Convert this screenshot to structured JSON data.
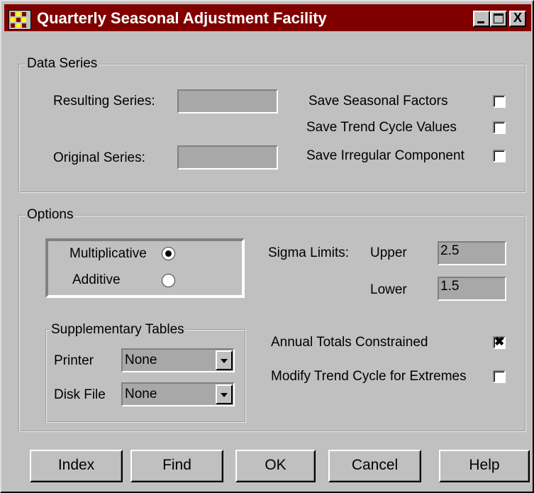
{
  "window": {
    "title": "Quarterly Seasonal Adjustment Facility"
  },
  "title_buttons": {
    "close": "X"
  },
  "data_series": {
    "label": "Data Series",
    "resulting_label": "Resulting Series:",
    "resulting_value": "",
    "original_label": "Original Series:",
    "original_value": "",
    "save_seasonal": {
      "label": "Save Seasonal Factors",
      "checked": false
    },
    "save_trend": {
      "label": "Save Trend Cycle Values",
      "checked": false
    },
    "save_irregular": {
      "label": "Save Irregular  Component",
      "checked": false
    }
  },
  "options": {
    "label": "Options",
    "multiplicative": {
      "label": "Multiplicative",
      "selected": true
    },
    "additive": {
      "label": "Additive",
      "selected": false
    },
    "sigma_label": "Sigma Limits:",
    "upper_label": "Upper",
    "upper_value": "2.5",
    "lower_label": "Lower",
    "lower_value": "1.5",
    "supplementary": {
      "label": "Supplementary Tables",
      "printer_label": "Printer",
      "printer_value": "None",
      "disk_label": "Disk File",
      "disk_value": "None"
    },
    "annual_totals": {
      "label": "Annual Totals Constrained",
      "checked": true,
      "mark": "✖"
    },
    "modify_trend": {
      "label": "Modify Trend Cycle for Extremes",
      "checked": false
    }
  },
  "buttons": {
    "index": "Index",
    "find": "Find",
    "ok": "OK",
    "cancel": "Cancel",
    "help": "Help"
  }
}
